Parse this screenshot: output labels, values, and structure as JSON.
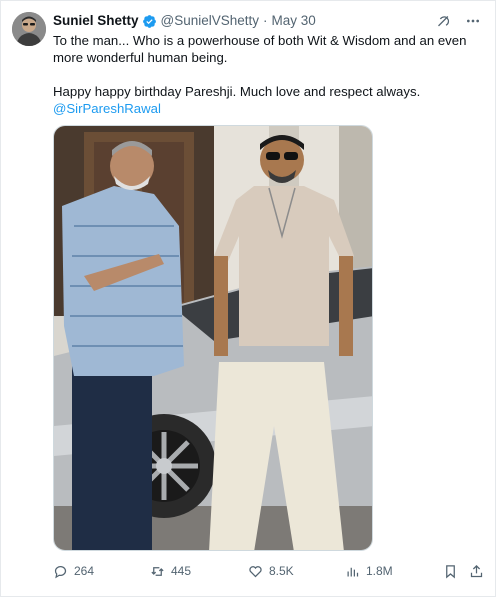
{
  "tweet": {
    "author_name": "Suniel Shetty",
    "handle": "@SunielVShetty",
    "separator": "·",
    "date": "May 30",
    "text_line1": "To the man... Who is a powerhouse of both Wit & Wisdom and an even more wonderful human being.",
    "text_line2": "Happy happy birthday Pareshji. Much love and respect always.",
    "mention": "@SirPareshRawal",
    "image_alt": "Paresh Rawal and Suniel Shetty standing beside a silver car"
  },
  "icons": {
    "verified": "verified-badge-icon",
    "grok": "grok-icon",
    "more": "more-icon",
    "reply": "reply-icon",
    "retweet": "retweet-icon",
    "like": "like-icon",
    "views": "views-icon",
    "bookmark": "bookmark-icon",
    "share": "share-icon"
  },
  "actions": {
    "replies": "264",
    "retweets": "445",
    "likes": "8.5K",
    "views": "1.8M"
  },
  "colors": {
    "accent": "#1d9bf0",
    "text": "#0f1419",
    "secondary": "#536471"
  }
}
